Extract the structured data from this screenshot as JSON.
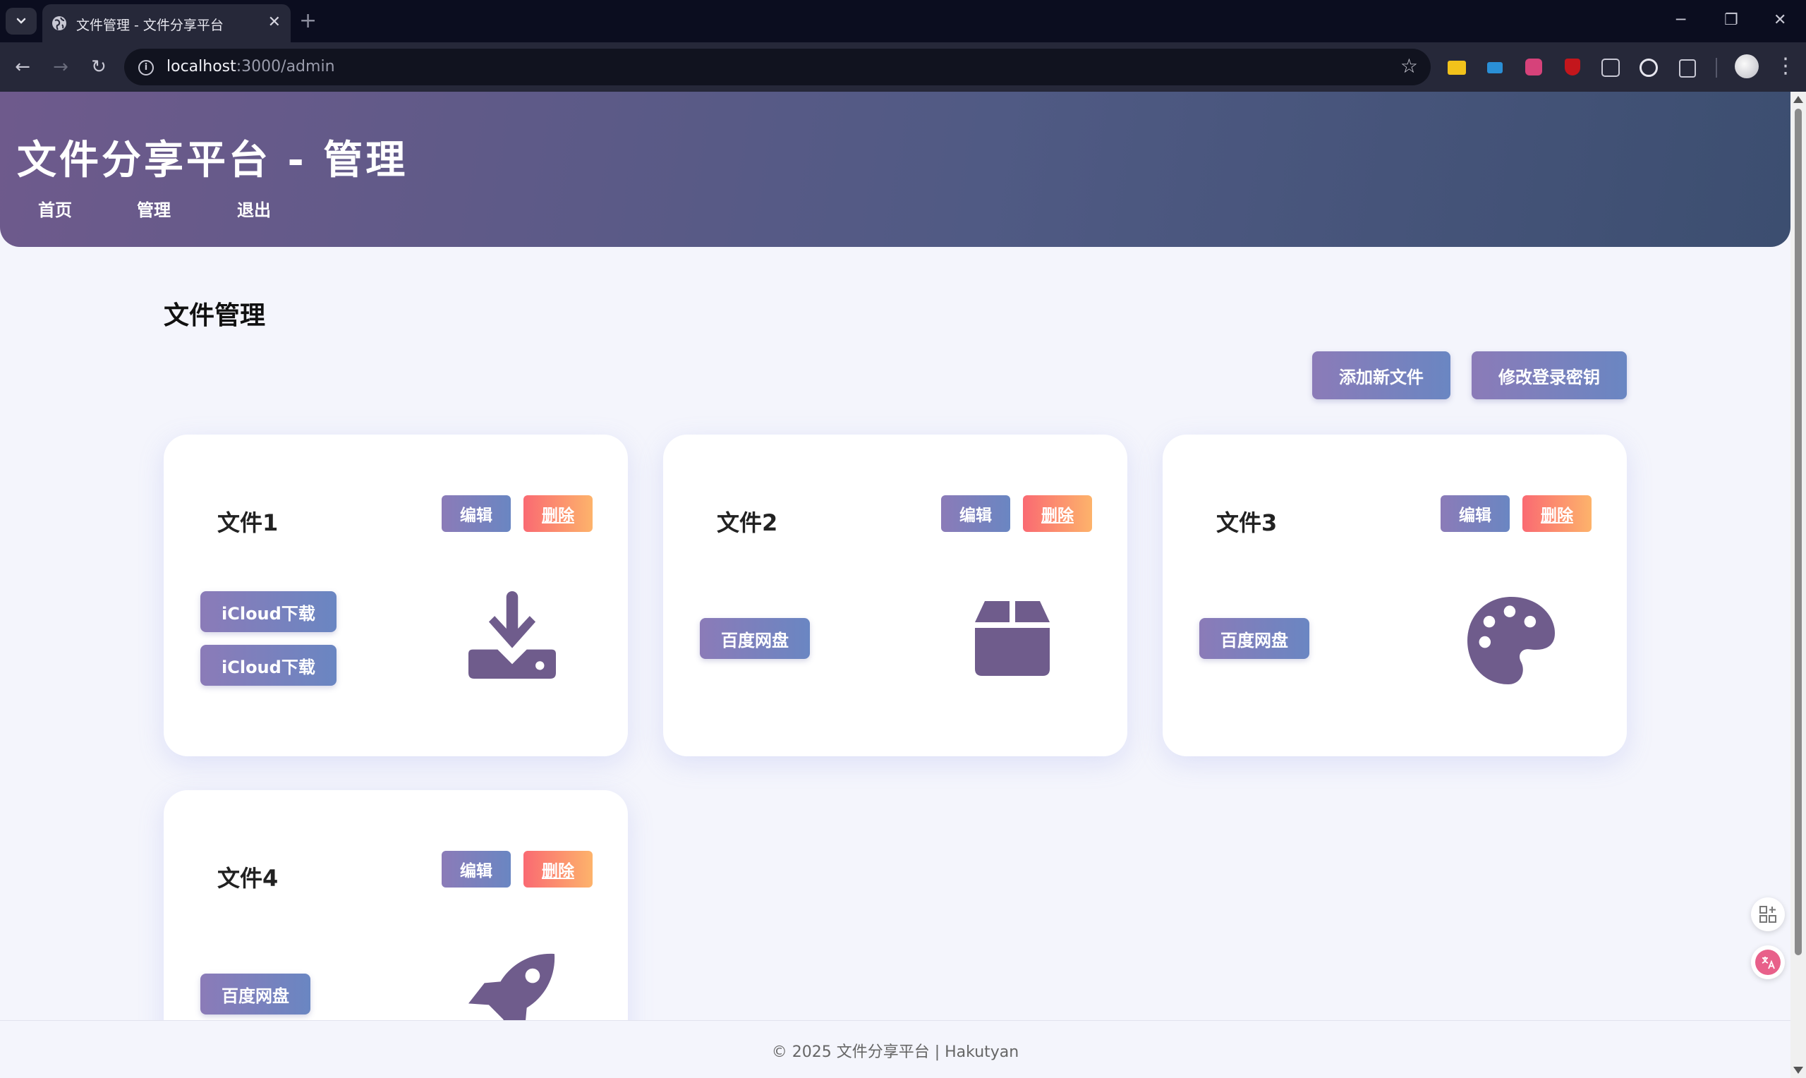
{
  "browser": {
    "tab_title": "文件管理 - 文件分享平台",
    "tab_close": "✕",
    "new_tab": "+",
    "url_host": "localhost",
    "url_path": ":3000/admin",
    "back": "←",
    "forward": "→",
    "reload": "↻",
    "star": "☆",
    "menu": "⋮",
    "win_minimize": "─",
    "win_restore": "❐",
    "win_close": "✕"
  },
  "header": {
    "title": "文件分享平台 - 管理",
    "nav": [
      "首页",
      "管理",
      "退出"
    ]
  },
  "main": {
    "section_title": "文件管理",
    "actions": {
      "add_file": "添加新文件",
      "change_key": "修改登录密钥"
    },
    "cards": [
      {
        "title": "文件1",
        "edit": "编辑",
        "delete": "删除",
        "links": [
          "iCloud下载",
          "iCloud下载"
        ],
        "icon": "download-icon"
      },
      {
        "title": "文件2",
        "edit": "编辑",
        "delete": "删除",
        "links": [
          "百度网盘"
        ],
        "icon": "box-icon"
      },
      {
        "title": "文件3",
        "edit": "编辑",
        "delete": "删除",
        "links": [
          "百度网盘"
        ],
        "icon": "palette-icon"
      },
      {
        "title": "文件4",
        "edit": "编辑",
        "delete": "删除",
        "links": [
          "百度网盘"
        ],
        "icon": "rocket-icon"
      }
    ]
  },
  "footer": {
    "text": "© 2025 文件分享平台 | Hakutyan"
  },
  "colors": {
    "accent": "#6f5c8c",
    "header_start": "#6e5a8c",
    "header_end": "#3c4e70",
    "delete_start": "#fa6a72",
    "delete_end": "#fdb36b"
  }
}
